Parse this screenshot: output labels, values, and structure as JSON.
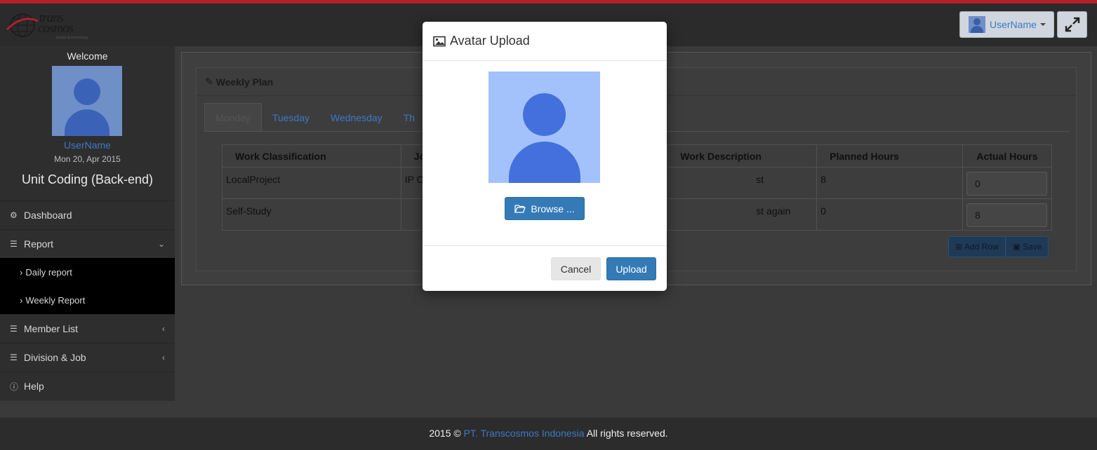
{
  "header": {
    "logo_line1": "trans",
    "logo_line2": "cosmos",
    "logo_tagline": "people & technology",
    "user_label": "UserName"
  },
  "sidebar": {
    "welcome": "Welcome",
    "username": "UserName",
    "date": "Mon 20, Apr 2015",
    "unit": "Unit Coding (Back-end)",
    "menu": [
      {
        "label": "Dashboard",
        "icon": "dashboard-icon"
      },
      {
        "label": "Report",
        "icon": "list-icon",
        "expanded": true
      },
      {
        "label": "Member List",
        "icon": "list-icon"
      },
      {
        "label": "Division & Job",
        "icon": "list-icon"
      },
      {
        "label": "Help",
        "icon": "info-icon"
      }
    ],
    "submenu": [
      {
        "label": "Daily report"
      },
      {
        "label": "Weekly Report"
      }
    ]
  },
  "panel": {
    "title": "Weekly Plan",
    "tabs": [
      "Monday",
      "Tuesday",
      "Wednesday",
      "Th"
    ],
    "active_tab": "Monday",
    "columns": [
      "Work Classification",
      "Jo",
      "Work Description",
      "Planned Hours",
      "Actual Hours"
    ],
    "rows": [
      {
        "classification": "LocalProject",
        "job": "IP C",
        "description": "st",
        "planned": "8",
        "actual": "0"
      },
      {
        "classification": "Self-Study",
        "job": "",
        "description": "st again",
        "planned": "0",
        "actual": "8"
      }
    ],
    "add_row_label": "Add Row",
    "save_label": "Save"
  },
  "modal": {
    "title": "Avatar Upload",
    "browse_label": "Browse ...",
    "cancel_label": "Cancel",
    "upload_label": "Upload"
  },
  "footer": {
    "prefix": "2015 © ",
    "company": "PT. Transcosmos Indonesia",
    "suffix": " All rights reserved."
  },
  "colors": {
    "accent_red": "#b3202a",
    "link_blue": "#3c79c6",
    "primary_button": "#337ab7",
    "avatar_bg": "#a3c1fb",
    "avatar_fg": "#4370dc"
  }
}
